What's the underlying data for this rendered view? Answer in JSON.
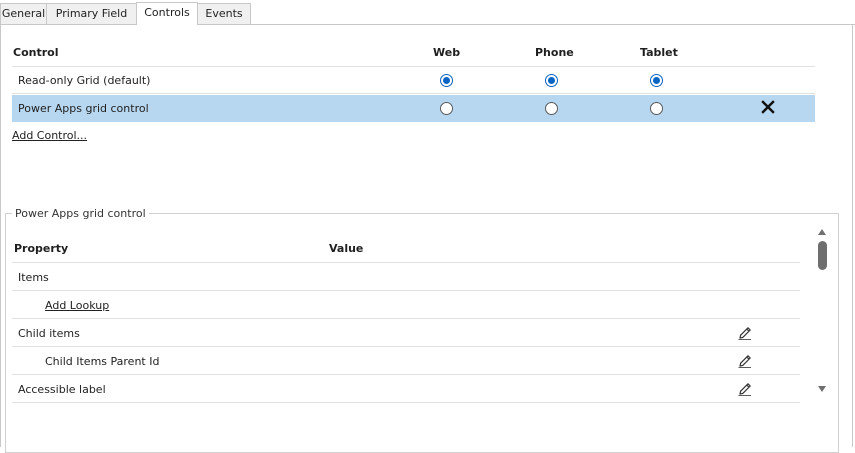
{
  "tabs": [
    {
      "label": "General"
    },
    {
      "label": "Primary Field"
    },
    {
      "label": "Controls",
      "active": true
    },
    {
      "label": "Events"
    }
  ],
  "controls": {
    "headers": {
      "control": "Control",
      "web": "Web",
      "phone": "Phone",
      "tablet": "Tablet"
    },
    "rows": [
      {
        "name": "Read-only Grid (default)",
        "web": true,
        "phone": true,
        "tablet": true,
        "selected": false
      },
      {
        "name": "Power Apps grid control",
        "web": false,
        "phone": false,
        "tablet": false,
        "selected": true
      }
    ],
    "add_control_label": "Add Control..."
  },
  "properties": {
    "group_title": "Power Apps grid control",
    "headers": {
      "property": "Property",
      "value": "Value"
    },
    "rows": [
      {
        "label": "Items",
        "editable": false
      },
      {
        "label": "Add Lookup",
        "link": true,
        "editable": false
      },
      {
        "label": "Child items",
        "editable": true
      },
      {
        "label": "Child Items Parent Id",
        "editable": true
      },
      {
        "label": "Accessible label",
        "editable": true
      }
    ]
  },
  "icons": {
    "remove": "close-icon",
    "edit": "pencil-icon"
  },
  "colors": {
    "selected_row": "#b7d7f0",
    "radio_on": "#0b63c4"
  }
}
